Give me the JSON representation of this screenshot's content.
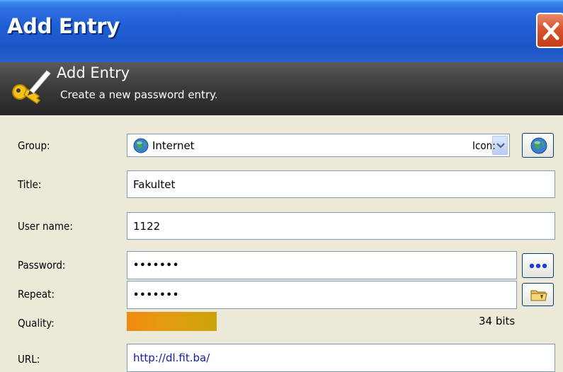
{
  "window": {
    "title": "Add Entry"
  },
  "banner": {
    "title": "Add Entry",
    "subtitle": "Create a new password entry.",
    "icon": "key-pencil-icon"
  },
  "form": {
    "group": {
      "label": "Group:",
      "value": "Internet",
      "icon": "globe-icon"
    },
    "icon_label": "Icon:",
    "title": {
      "label": "Title:",
      "value": "Fakultet"
    },
    "username": {
      "label": "User name:",
      "value": "1122"
    },
    "password": {
      "label": "Password:",
      "value": "•••••••"
    },
    "repeat": {
      "label": "Repeat:",
      "value": "•••••••"
    },
    "quality": {
      "label": "Quality:",
      "value_text": "34 bits"
    },
    "url": {
      "label": "URL:",
      "value": "http://dl.fit.ba/"
    }
  }
}
